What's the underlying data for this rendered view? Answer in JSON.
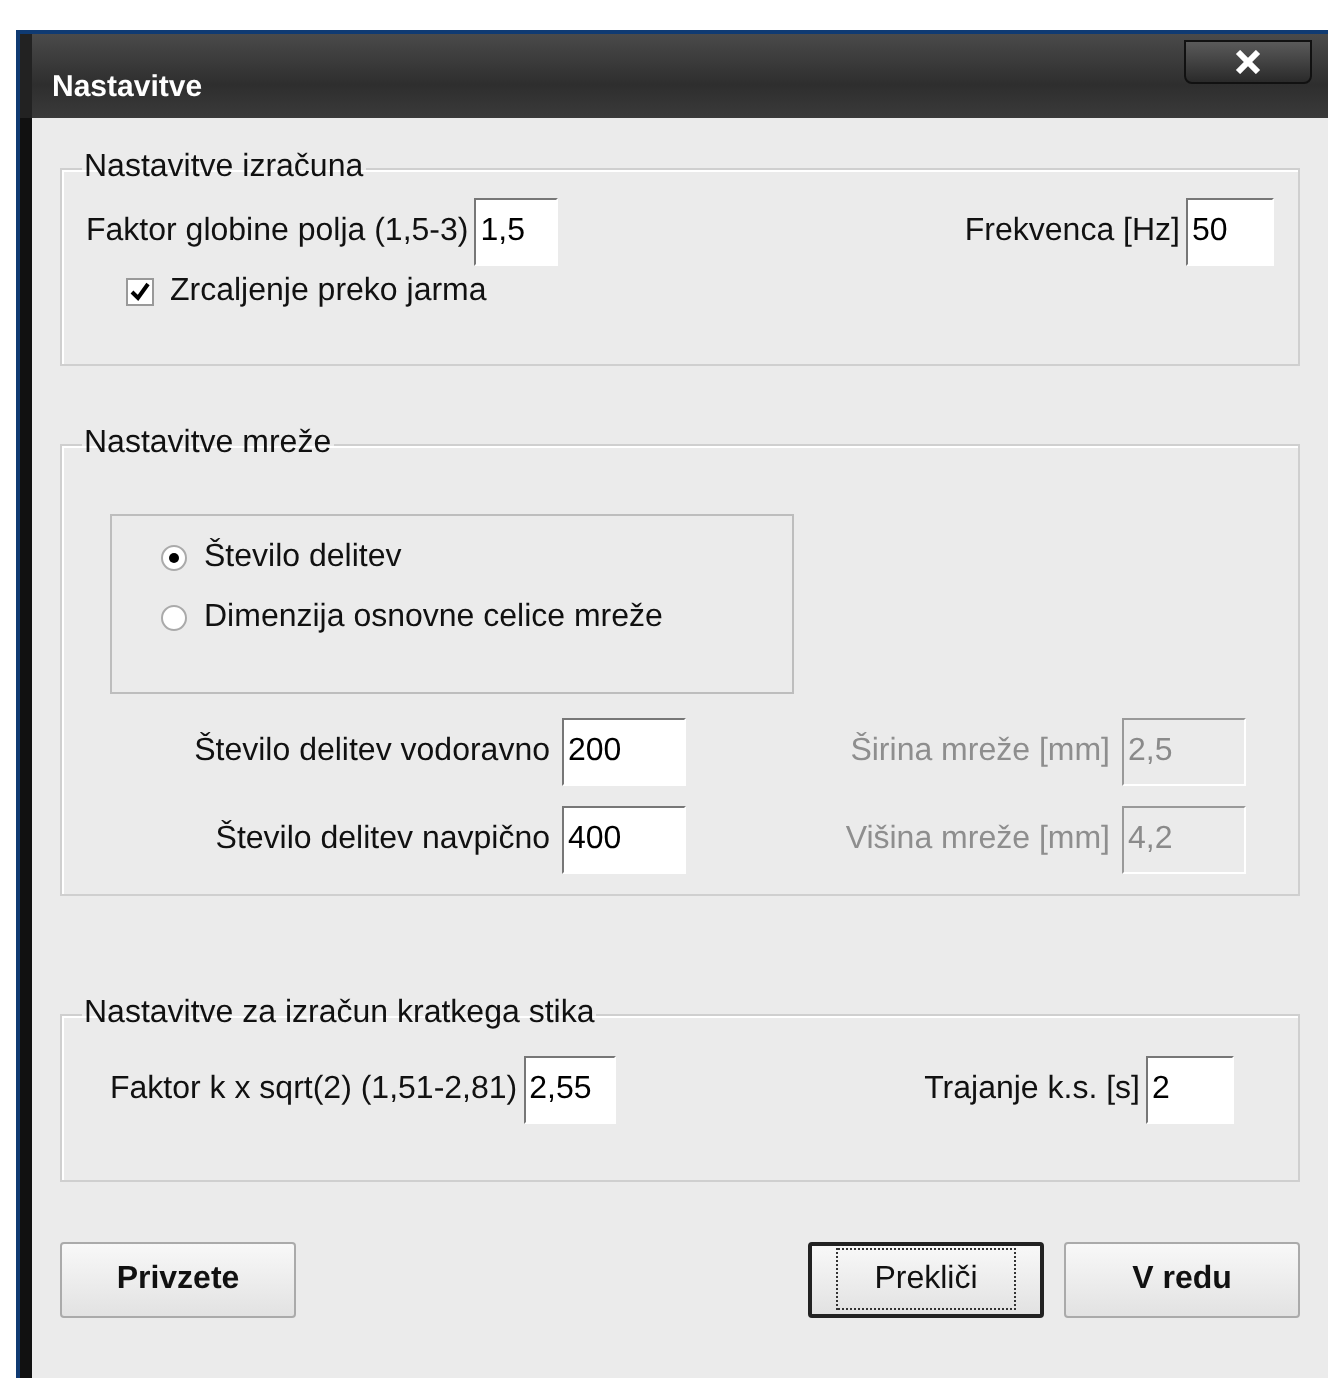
{
  "window": {
    "title": "Nastavitve"
  },
  "calculation": {
    "title": "Nastavitve izračuna",
    "fields": [
      {
        "label": "Faktor globine polja (1,5-3)",
        "value": "1,5",
        "disabled": false
      },
      {
        "label": "Frekvenca [Hz]",
        "value": "50",
        "disabled": false
      }
    ],
    "checkbox": {
      "label": "Zrcaljenje preko jarma",
      "checked": true
    }
  },
  "mesh": {
    "title": "Nastavitve mreže",
    "options": [
      {
        "label": "Število delitev",
        "selected": true
      },
      {
        "label": "Dimenzija osnovne celice mreže",
        "selected": false
      }
    ],
    "rows": [
      [
        {
          "label": "Število delitev vodoravno",
          "value": "200",
          "disabled": false
        },
        {
          "label": "Širina mreže [mm]",
          "value": "2,5",
          "disabled": true
        }
      ],
      [
        {
          "label": "Število delitev navpično",
          "value": "400",
          "disabled": false
        },
        {
          "label": "Višina mreže [mm]",
          "value": "4,2",
          "disabled": true
        }
      ]
    ]
  },
  "short_circuit": {
    "title": "Nastavitve za izračun kratkega stika",
    "fields": [
      {
        "label": "Faktor k x sqrt(2) (1,51-2,81)",
        "value": "2,55",
        "disabled": false
      },
      {
        "label": "Trajanje k.s. [s]",
        "value": "2",
        "disabled": false
      }
    ]
  },
  "buttons": [
    {
      "label": "Privzete",
      "bold": true,
      "focused": false
    },
    {
      "label": "Prekliči",
      "bold": false,
      "focused": true
    },
    {
      "label": "V redu",
      "bold": true,
      "focused": false
    }
  ]
}
